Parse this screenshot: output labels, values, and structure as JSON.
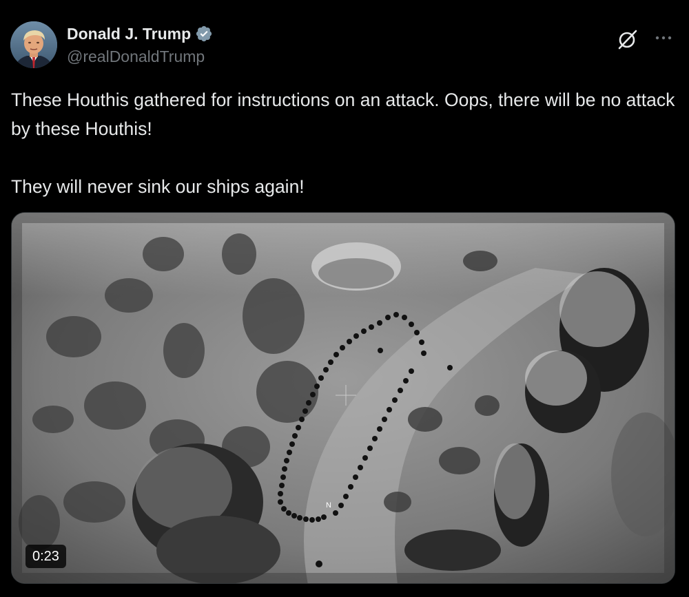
{
  "author": {
    "name": "Donald J. Trump",
    "handle": "@realDonaldTrump",
    "verified": true,
    "avatar_icon": "profile-photo"
  },
  "post": {
    "text": "These Houthis gathered for instructions on an attack. Oops, there will be no attack by these Houthis!\n\nThey will never sink our ships again!"
  },
  "media": {
    "type": "video",
    "duration": "0:23",
    "overlay_mark": "N"
  },
  "actions": {
    "grok_icon": "grok-slash-icon",
    "more_icon": "more-dots-icon"
  },
  "colors": {
    "background": "#000000",
    "text": "#e7e9ea",
    "secondary_text": "#71767b",
    "verified_badge": "#829aab"
  }
}
